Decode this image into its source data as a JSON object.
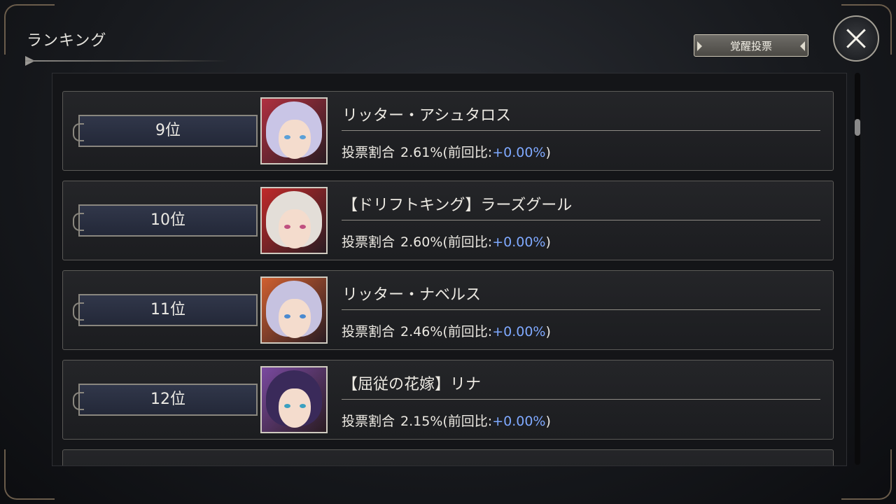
{
  "header": {
    "title": "ランキング",
    "awaken_button": "覚醒投票"
  },
  "colors": {
    "delta": "#7fa9ff",
    "panel": "#141518"
  },
  "rankings": [
    {
      "rank": "9位",
      "name": "リッター・アシュタロス",
      "vote_label": "投票割合",
      "pct": "2.61%",
      "prev_open": "(前回比:",
      "delta": "+0.00%",
      "prev_close": ")",
      "hair": "#c9c5e6",
      "accent": "#b03040",
      "eye": "#5aa0d8"
    },
    {
      "rank": "10位",
      "name": "【ドリフトキング】ラーズグール",
      "vote_label": "投票割合",
      "pct": "2.60%",
      "prev_open": "(前回比:",
      "delta": "+0.00%",
      "prev_close": ")",
      "hair": "#e3ded8",
      "accent": "#c02a2a",
      "eye": "#c05080"
    },
    {
      "rank": "11位",
      "name": "リッター・ナベルス",
      "vote_label": "投票割合",
      "pct": "2.46%",
      "prev_open": "(前回比:",
      "delta": "+0.00%",
      "prev_close": ")",
      "hair": "#c6c2e0",
      "accent": "#d06030",
      "eye": "#4a8ad0"
    },
    {
      "rank": "12位",
      "name": "【屈従の花嫁】リナ",
      "vote_label": "投票割合",
      "pct": "2.15%",
      "prev_open": "(前回比:",
      "delta": "+0.00%",
      "prev_close": ")",
      "hair": "#3a2a5a",
      "accent": "#7a4aa0",
      "eye": "#3aa0c0"
    }
  ]
}
